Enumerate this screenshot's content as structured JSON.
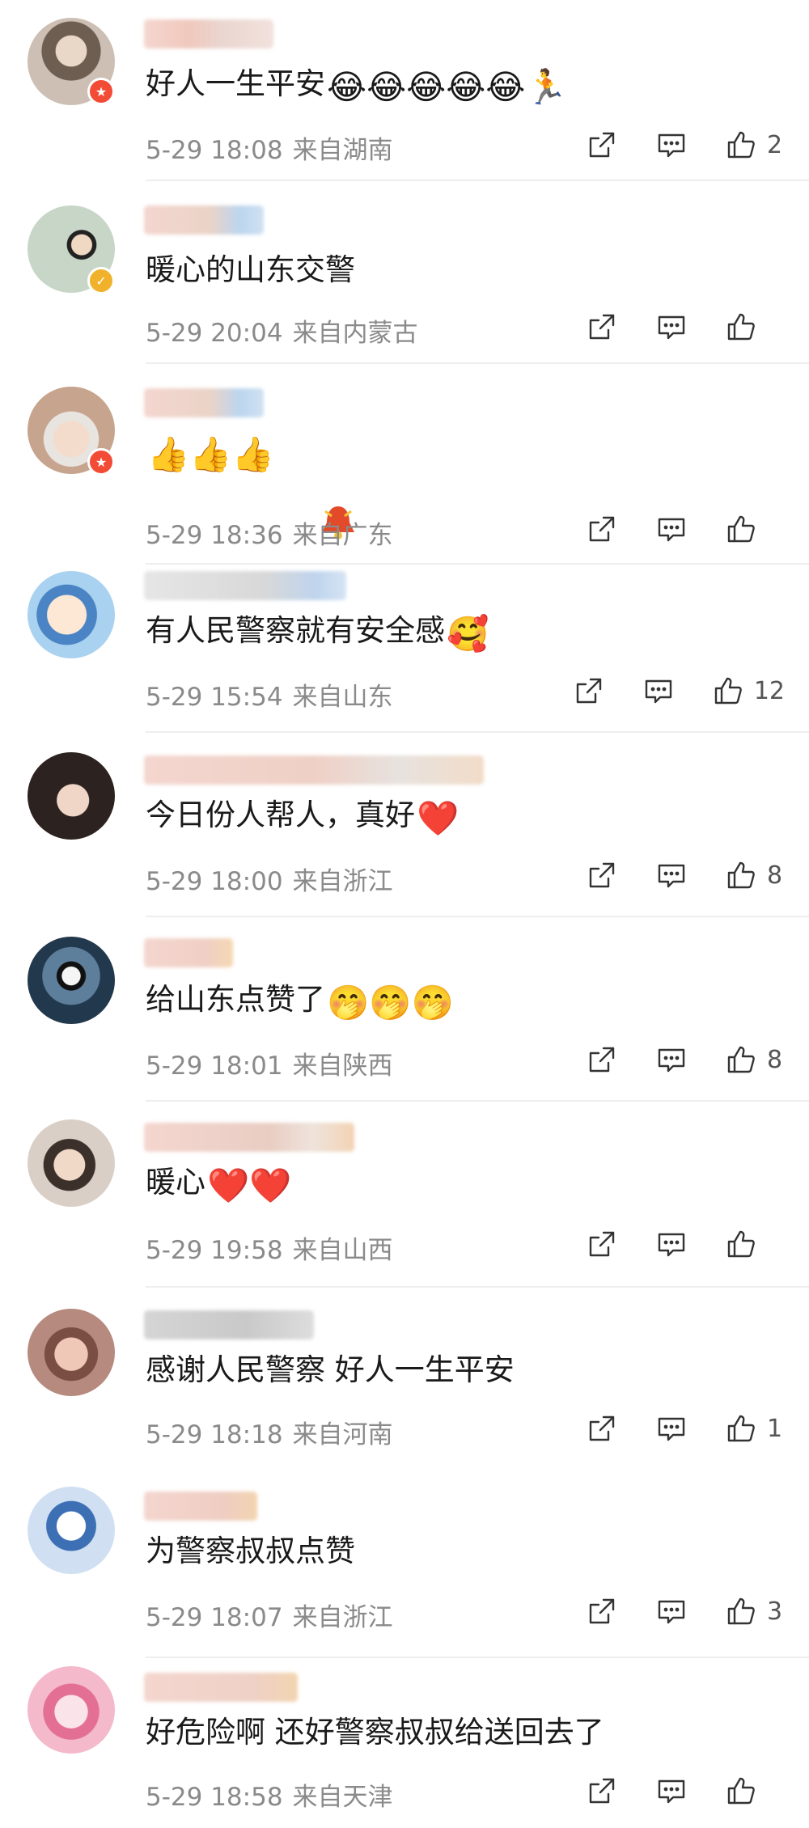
{
  "comments": [
    {
      "text": "好人一生平安",
      "emojis": "😂😂😂😂😂🏃",
      "time": "5-29 18:08",
      "location": "来自湖南",
      "likes": "2",
      "badge": "red",
      "avatar_color": "#8c7a6b"
    },
    {
      "text": "暖心的山东交警",
      "emojis": "",
      "time": "5-29 20:04",
      "location": "来自内蒙古",
      "likes": "",
      "badge": "gold",
      "avatar_color": "#5a6f86"
    },
    {
      "text": "",
      "emojis": "👍👍👍",
      "time": "5-29 18:36",
      "location": "来自广东",
      "likes": "",
      "badge": "red",
      "avatar_color": "#c9a48b"
    },
    {
      "text": "有人民警察就有安全感",
      "emojis": "🥰",
      "time": "5-29 15:54",
      "location": "来自山东",
      "likes": "12",
      "badge": "",
      "avatar_color": "#7fb2d8"
    },
    {
      "text": "今日份人帮人，真好",
      "emojis": "❤️",
      "time": "5-29 18:00",
      "location": "来自浙江",
      "likes": "8",
      "badge": "",
      "avatar_color": "#4a3d38"
    },
    {
      "text": "给山东点赞了",
      "emojis": "🤭🤭🤭",
      "time": "5-29 18:01",
      "location": "来自陕西",
      "likes": "8",
      "badge": "",
      "avatar_color": "#2f4658"
    },
    {
      "text": "暖心",
      "emojis": "❤️❤️",
      "time": "5-29 19:58",
      "location": "来自山西",
      "likes": "",
      "badge": "",
      "avatar_color": "#6b5a50"
    },
    {
      "text": "感谢人民警察 好人一生平安",
      "emojis": "",
      "time": "5-29 18:18",
      "location": "来自河南",
      "likes": "1",
      "badge": "",
      "avatar_color": "#a8746a"
    },
    {
      "text": "为警察叔叔点赞",
      "emojis": "",
      "time": "5-29 18:07",
      "location": "来自浙江",
      "likes": "3",
      "badge": "",
      "avatar_color": "#3f6fb0"
    },
    {
      "text": "好危险啊 还好警察叔叔给送回去了",
      "emojis": "",
      "time": "5-29 18:58",
      "location": "来自天津",
      "likes": "",
      "badge": "",
      "avatar_color": "#e9a3b8"
    }
  ],
  "icons": {
    "share": "share-icon",
    "comment": "comment-icon",
    "like": "thumbs-up-icon"
  }
}
